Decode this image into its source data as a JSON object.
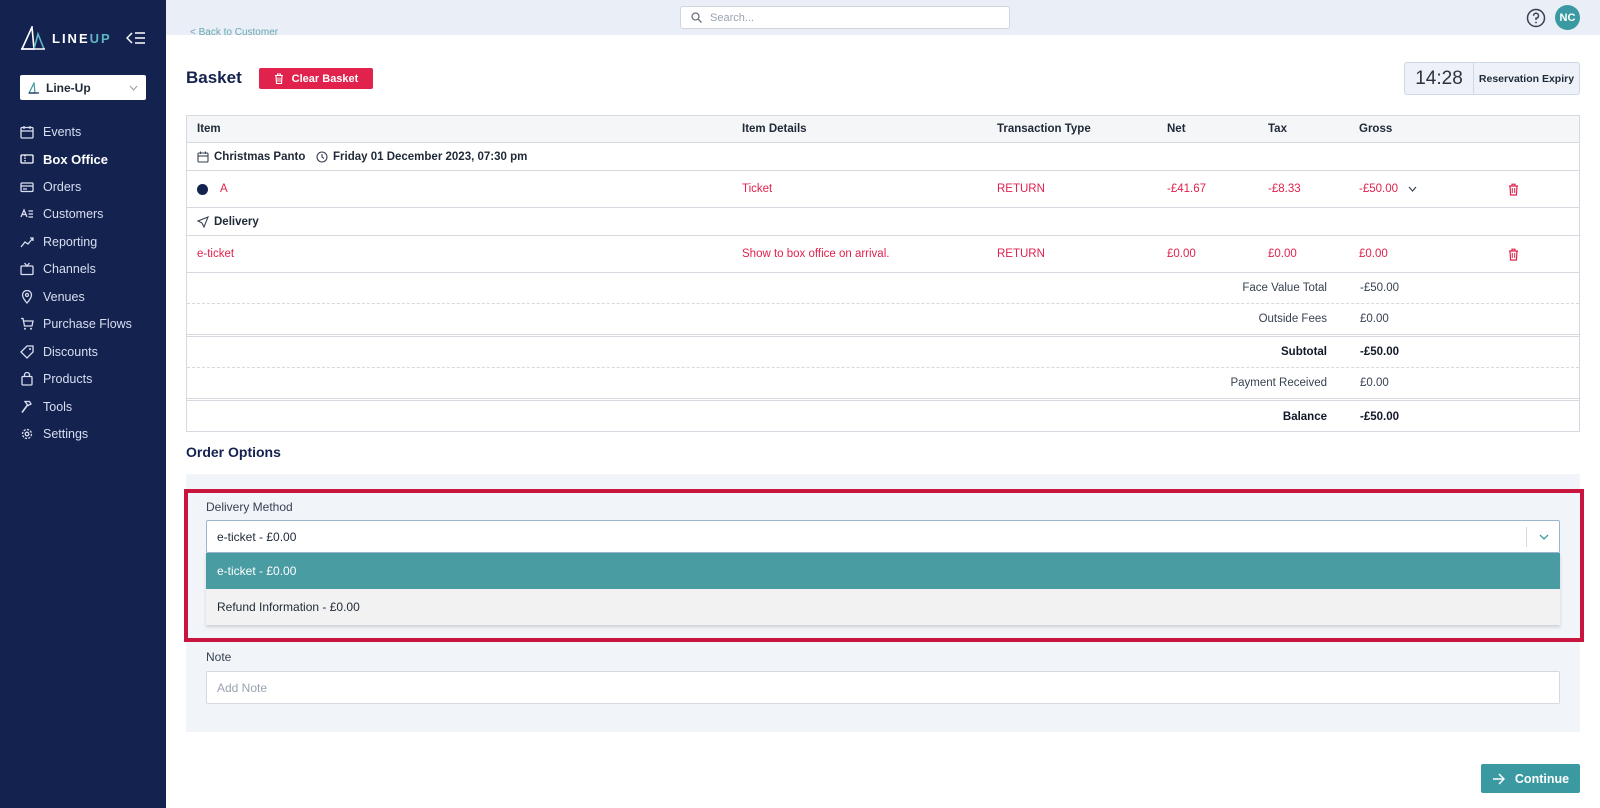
{
  "app": {
    "logo_text_a": "LINE",
    "logo_text_b": "UP",
    "org_selector": "Line-Up"
  },
  "sidebar": {
    "items": [
      {
        "label": "Events",
        "icon": "calendar-icon"
      },
      {
        "label": "Box Office",
        "icon": "ticket-icon",
        "active": true
      },
      {
        "label": "Orders",
        "icon": "card-icon"
      },
      {
        "label": "Customers",
        "icon": "customers-icon"
      },
      {
        "label": "Reporting",
        "icon": "chart-icon"
      },
      {
        "label": "Channels",
        "icon": "tv-icon"
      },
      {
        "label": "Venues",
        "icon": "map-pin-icon"
      },
      {
        "label": "Purchase Flows",
        "icon": "cart-icon"
      },
      {
        "label": "Discounts",
        "icon": "tag-icon"
      },
      {
        "label": "Products",
        "icon": "bag-icon"
      },
      {
        "label": "Tools",
        "icon": "hammer-icon"
      },
      {
        "label": "Settings",
        "icon": "gear-icon"
      }
    ]
  },
  "topbar": {
    "search_placeholder": "Search...",
    "avatar_initials": "NC"
  },
  "back_link": "< Back to Customer",
  "basket": {
    "title": "Basket",
    "clear_label": "Clear Basket",
    "reservation_time": "14:28",
    "reservation_label": "Reservation Expiry",
    "columns": [
      "Item",
      "Item Details",
      "Transaction Type",
      "Net",
      "Tax",
      "Gross"
    ],
    "event": {
      "name": "Christmas Panto",
      "datetime": "Friday 01 December 2023, 07:30 pm"
    },
    "ticket": {
      "item": "A",
      "details": "Ticket",
      "type": "RETURN",
      "net": "-£41.67",
      "tax": "-£8.33",
      "gross": "-£50.00"
    },
    "delivery_header": "Delivery",
    "delivery": {
      "item": "e-ticket",
      "details": "Show to box office on arrival.",
      "type": "RETURN",
      "net": "£0.00",
      "tax": "£0.00",
      "gross": "£0.00"
    },
    "summary": [
      {
        "label": "Face Value Total",
        "value": "-£50.00"
      },
      {
        "label": "Outside Fees",
        "value": "£0.00"
      },
      {
        "label": "Subtotal",
        "value": "-£50.00"
      },
      {
        "label": "Payment Received",
        "value": "£0.00"
      },
      {
        "label": "Balance",
        "value": "-£50.00"
      }
    ]
  },
  "order_options": {
    "title": "Order Options",
    "delivery_method_label": "Delivery Method",
    "delivery_method_value": "e-ticket - £0.00",
    "options": [
      "e-ticket - £0.00",
      "Refund Information - £0.00"
    ],
    "note_label": "Note",
    "note_placeholder": "Add Note"
  },
  "continue_label": "Continue",
  "colors": {
    "sidebar": "#14224f",
    "accent": "#3b9aa1",
    "danger": "#e0224d",
    "highlight": "#c8143f"
  }
}
